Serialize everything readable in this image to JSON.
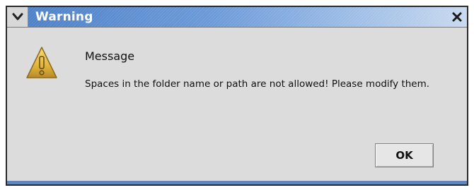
{
  "window": {
    "title": "Warning",
    "menu_icon": "chevron-down-icon",
    "close_icon": "close-icon"
  },
  "dialog": {
    "icon": "warning-icon",
    "heading": "Message",
    "body": "Spaces in the folder name or path are not allowed! Please modify them.",
    "ok_label": "OK"
  },
  "colors": {
    "titlebar_accent": "#4a7ec6",
    "window_bg": "#dcdcdc",
    "warning_icon": "#e0b53a"
  }
}
